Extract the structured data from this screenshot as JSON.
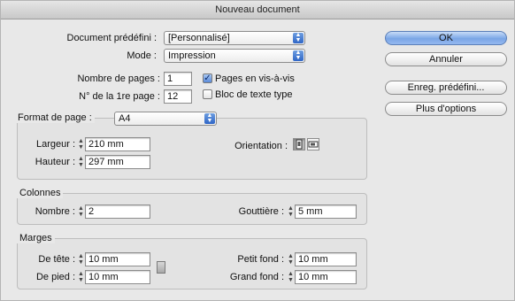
{
  "window": {
    "title": "Nouveau document"
  },
  "top": {
    "preset_label": "Document prédéfini :",
    "preset_value": "[Personnalisé]",
    "mode_label": "Mode :",
    "mode_value": "Impression",
    "pages_label": "Nombre de pages :",
    "pages_value": "1",
    "first_page_label": "N° de la 1re page :",
    "first_page_value": "12",
    "facing_pages_label": "Pages en vis-à-vis",
    "facing_pages_checked": true,
    "text_frame_label": "Bloc de texte type",
    "text_frame_checked": false
  },
  "buttons": {
    "ok": "OK",
    "cancel": "Annuler",
    "save_preset": "Enreg. prédéfini...",
    "more_options": "Plus d'options"
  },
  "page_format": {
    "label": "Format de page :",
    "value": "A4",
    "width_label": "Largeur :",
    "width_value": "210 mm",
    "height_label": "Hauteur :",
    "height_value": "297 mm",
    "orientation_label": "Orientation :",
    "orientation_selected": "portrait"
  },
  "columns": {
    "legend": "Colonnes",
    "number_label": "Nombre :",
    "number_value": "2",
    "gutter_label": "Gouttière :",
    "gutter_value": "5 mm"
  },
  "margins": {
    "legend": "Marges",
    "top_label": "De tête :",
    "top_value": "10 mm",
    "bottom_label": "De pied :",
    "bottom_value": "10 mm",
    "inside_label": "Petit fond :",
    "inside_value": "10 mm",
    "outside_label": "Grand fond :",
    "outside_value": "10 mm"
  },
  "icons": {
    "popup_arrows": "up-down-arrows-icon",
    "stepper": "stepper-icon",
    "check": "checkmark-icon",
    "portrait": "portrait-orientation-icon",
    "landscape": "landscape-orientation-icon",
    "link": "chain-link-icon"
  },
  "colors": {
    "default_button": "#7aa5e6",
    "popup_arrow": "#2f66c7"
  }
}
